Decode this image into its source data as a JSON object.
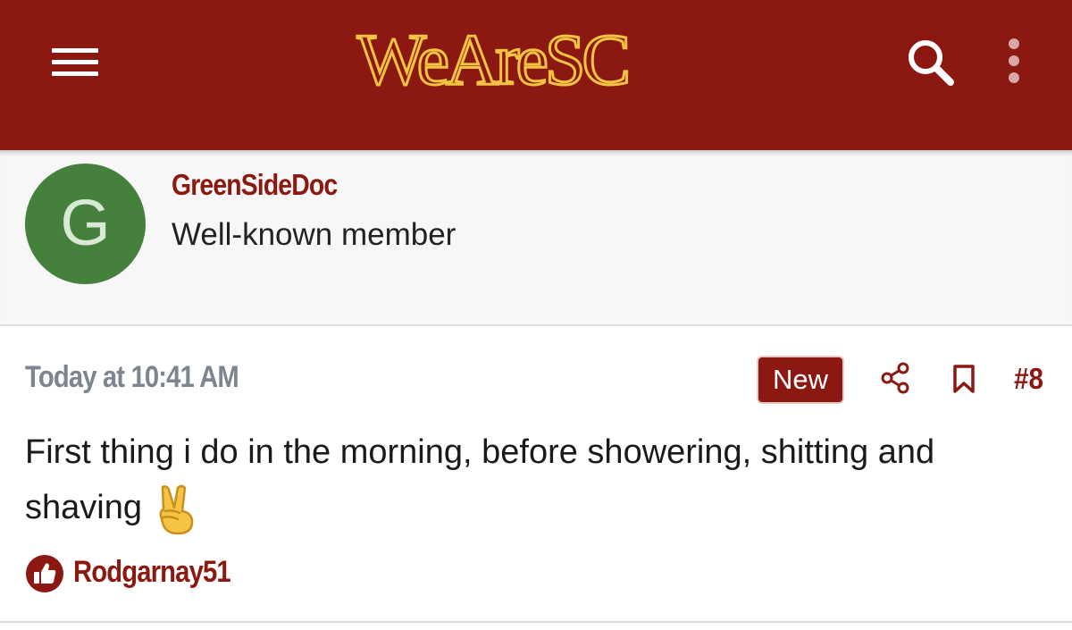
{
  "header": {
    "logo": "WeAreSC",
    "icons": {
      "menu": "hamburger-menu-icon",
      "search": "search-icon",
      "more": "kebab-menu-icon"
    },
    "colors": {
      "bar": "#8b1911",
      "logo_outline": "#f2c342"
    }
  },
  "author": {
    "avatar_letter": "G",
    "avatar_color": "#45813c",
    "username": "GreenSideDoc",
    "title": "Well-known member"
  },
  "post": {
    "date": "Today at 10:41 AM",
    "badge": "New",
    "number": "#8",
    "body": "First thing i do in the morning, before showering, shitting and shaving",
    "emoji": "victory-hand-emoji",
    "icons": {
      "share": "share-icon",
      "bookmark": "bookmark-icon",
      "like": "thumbs-up-icon"
    },
    "reaction_user": "Rodgarnay51"
  }
}
